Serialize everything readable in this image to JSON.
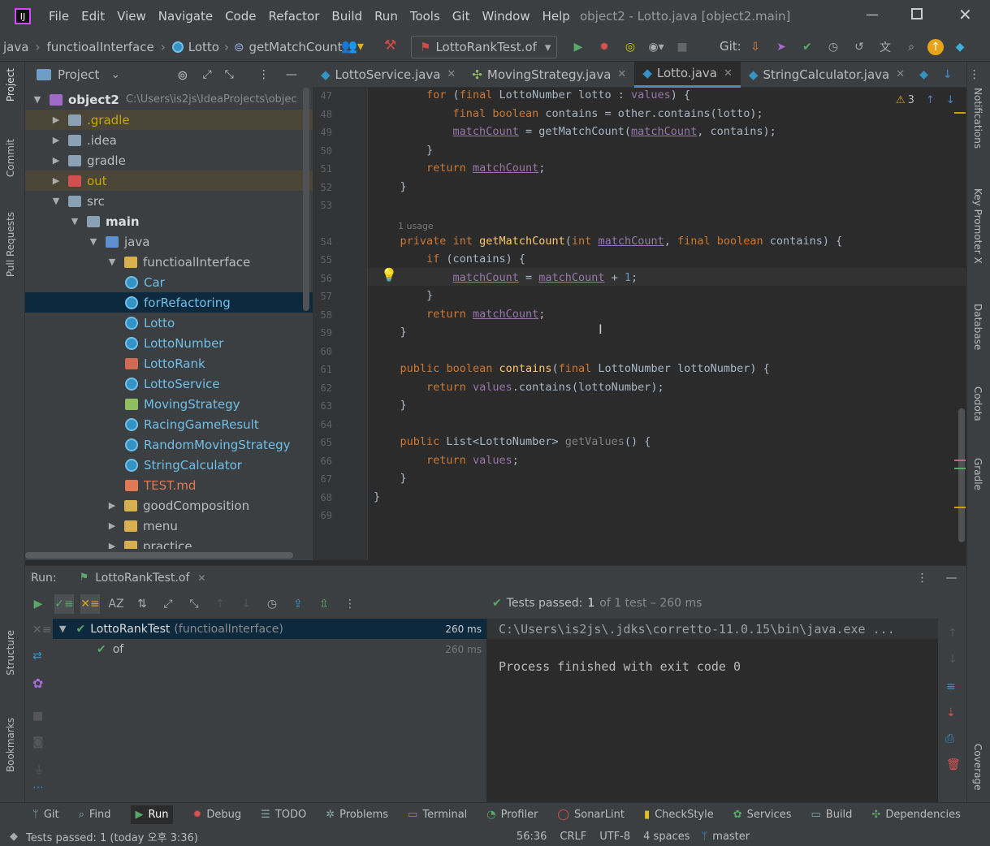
{
  "menu": [
    "File",
    "Edit",
    "View",
    "Navigate",
    "Code",
    "Refactor",
    "Build",
    "Run",
    "Tools",
    "Git",
    "Window",
    "Help"
  ],
  "window_title": "object2 - Lotto.java [object2.main]",
  "breadcrumb": [
    "java",
    "functioalInterface",
    "Lotto",
    "getMatchCount"
  ],
  "run_config": "LottoRankTest.of",
  "git_label": "Git:",
  "project_panel": {
    "title": "Project",
    "root": "object2",
    "root_path": "C:\\Users\\is2js\\IdeaProjects\\objec",
    "items": [
      {
        "label": ".gradle",
        "indent": 1,
        "arrow": "right",
        "color": "#c8a800",
        "icon": "folder",
        "hl": true
      },
      {
        "label": ".idea",
        "indent": 1,
        "arrow": "right",
        "color": "#bbbbbb",
        "icon": "folder"
      },
      {
        "label": "gradle",
        "indent": 1,
        "arrow": "right",
        "color": "#bbbbbb",
        "icon": "folder"
      },
      {
        "label": "out",
        "indent": 1,
        "arrow": "right",
        "color": "#c8a800",
        "icon": "folder-red",
        "hl": true
      },
      {
        "label": "src",
        "indent": 1,
        "arrow": "down",
        "color": "#bbbbbb",
        "icon": "folder"
      },
      {
        "label": "main",
        "indent": 2,
        "arrow": "down",
        "color": "#dddddd",
        "icon": "folder",
        "bold": true
      },
      {
        "label": "java",
        "indent": 3,
        "arrow": "down",
        "color": "#bbbbbb",
        "icon": "folder-blue"
      },
      {
        "label": "functioalInterface",
        "indent": 4,
        "arrow": "down",
        "color": "#bbbbbb",
        "icon": "pkg"
      },
      {
        "label": "Car",
        "indent": 5,
        "arrow": "",
        "color": "#6fbfe8",
        "icon": "class"
      },
      {
        "label": "forRefactoring",
        "indent": 5,
        "arrow": "",
        "color": "#6fbfe8",
        "icon": "class",
        "sel": true
      },
      {
        "label": "Lotto",
        "indent": 5,
        "arrow": "",
        "color": "#6fbfe8",
        "icon": "class"
      },
      {
        "label": "LottoNumber",
        "indent": 5,
        "arrow": "",
        "color": "#6fbfe8",
        "icon": "class"
      },
      {
        "label": "LottoRank",
        "indent": 5,
        "arrow": "",
        "color": "#6fbfe8",
        "icon": "enum"
      },
      {
        "label": "LottoService",
        "indent": 5,
        "arrow": "",
        "color": "#6fbfe8",
        "icon": "class"
      },
      {
        "label": "MovingStrategy",
        "indent": 5,
        "arrow": "",
        "color": "#6fbfe8",
        "icon": "iface"
      },
      {
        "label": "RacingGameResult",
        "indent": 5,
        "arrow": "",
        "color": "#6fbfe8",
        "icon": "class"
      },
      {
        "label": "RandomMovingStrategy",
        "indent": 5,
        "arrow": "",
        "color": "#6fbfe8",
        "icon": "class"
      },
      {
        "label": "StringCalculator",
        "indent": 5,
        "arrow": "",
        "color": "#6fbfe8",
        "icon": "class"
      },
      {
        "label": "TEST.md",
        "indent": 5,
        "arrow": "",
        "color": "#e07a54",
        "icon": "md"
      },
      {
        "label": "goodComposition",
        "indent": 4,
        "arrow": "right",
        "color": "#bbbbbb",
        "icon": "pkg"
      },
      {
        "label": "menu",
        "indent": 4,
        "arrow": "right",
        "color": "#bbbbbb",
        "icon": "pkg"
      },
      {
        "label": "practice",
        "indent": 4,
        "arrow": "right",
        "color": "#bbbbbb",
        "icon": "pkg"
      }
    ]
  },
  "tabs": [
    {
      "label": "LottoService.java",
      "active": false,
      "icon": "class"
    },
    {
      "label": "MovingStrategy.java",
      "active": false,
      "icon": "iface"
    },
    {
      "label": "Lotto.java",
      "active": true,
      "icon": "class"
    },
    {
      "label": "StringCalculator.java",
      "active": false,
      "icon": "class"
    }
  ],
  "warning_count": "3",
  "code": [
    {
      "n": "47",
      "t": [
        [
          "        ",
          ""
        ],
        [
          "for",
          "kw"
        ],
        [
          " (",
          ""
        ],
        [
          "final",
          "kw"
        ],
        [
          " LottoNumber lotto : ",
          ""
        ],
        [
          "values",
          "fld"
        ],
        [
          ") {",
          ""
        ]
      ]
    },
    {
      "n": "48",
      "t": [
        [
          "            ",
          ""
        ],
        [
          "final",
          "kw"
        ],
        [
          " ",
          ""
        ],
        [
          "boolean",
          "kw"
        ],
        [
          " contains = other.contains(lotto);",
          ""
        ]
      ]
    },
    {
      "n": "49",
      "t": [
        [
          "            ",
          ""
        ],
        [
          "matchCount",
          "ul"
        ],
        [
          " = getMatchCount(",
          ""
        ],
        [
          "matchCount",
          "ul"
        ],
        [
          ", contains);",
          ""
        ]
      ]
    },
    {
      "n": "50",
      "t": [
        [
          "        }",
          ""
        ]
      ]
    },
    {
      "n": "51",
      "t": [
        [
          "        ",
          ""
        ],
        [
          "return",
          "kw"
        ],
        [
          " ",
          ""
        ],
        [
          "matchCount",
          "ul"
        ],
        [
          ";",
          ""
        ]
      ]
    },
    {
      "n": "52",
      "t": [
        [
          "    }",
          ""
        ]
      ]
    },
    {
      "n": "53",
      "t": [
        [
          "",
          ""
        ]
      ]
    },
    {
      "n": "",
      "usage": "1 usage"
    },
    {
      "n": "54",
      "t": [
        [
          "    ",
          ""
        ],
        [
          "private",
          "kw"
        ],
        [
          " ",
          ""
        ],
        [
          "int",
          "kw"
        ],
        [
          " ",
          ""
        ],
        [
          "getMatchCount",
          "fn"
        ],
        [
          "(",
          ""
        ],
        [
          "int",
          "kw"
        ],
        [
          " ",
          ""
        ],
        [
          "matchCount",
          "ul"
        ],
        [
          ", ",
          ""
        ],
        [
          "final",
          "kw"
        ],
        [
          " ",
          ""
        ],
        [
          "boolean",
          "kw"
        ],
        [
          " contains) {",
          ""
        ]
      ]
    },
    {
      "n": "55",
      "t": [
        [
          "        ",
          ""
        ],
        [
          "if",
          "kw"
        ],
        [
          " (contains) {",
          ""
        ]
      ]
    },
    {
      "n": "56",
      "t": [
        [
          "            ",
          ""
        ],
        [
          "matchCount",
          "ul"
        ],
        [
          " = ",
          ""
        ],
        [
          "matchCount",
          "ul"
        ],
        [
          " + ",
          ""
        ],
        [
          "1",
          "num"
        ],
        [
          ";",
          ""
        ]
      ]
    },
    {
      "n": "57",
      "t": [
        [
          "        }",
          ""
        ]
      ]
    },
    {
      "n": "58",
      "t": [
        [
          "        ",
          ""
        ],
        [
          "return",
          "kw"
        ],
        [
          " ",
          ""
        ],
        [
          "matchCount",
          "ul"
        ],
        [
          ";",
          ""
        ]
      ]
    },
    {
      "n": "59",
      "t": [
        [
          "    }",
          ""
        ]
      ]
    },
    {
      "n": "60",
      "t": [
        [
          "",
          ""
        ]
      ]
    },
    {
      "n": "61",
      "t": [
        [
          "    ",
          ""
        ],
        [
          "public",
          "kw"
        ],
        [
          " ",
          ""
        ],
        [
          "boolean",
          "kw"
        ],
        [
          " ",
          ""
        ],
        [
          "contains",
          "fn"
        ],
        [
          "(",
          ""
        ],
        [
          "final",
          "kw"
        ],
        [
          " LottoNumber lottoNumber) {",
          ""
        ]
      ]
    },
    {
      "n": "62",
      "t": [
        [
          "        ",
          ""
        ],
        [
          "return",
          "kw"
        ],
        [
          " ",
          ""
        ],
        [
          "values",
          "fld"
        ],
        [
          ".contains(lottoNumber);",
          ""
        ]
      ]
    },
    {
      "n": "63",
      "t": [
        [
          "    }",
          ""
        ]
      ]
    },
    {
      "n": "64",
      "t": [
        [
          "",
          ""
        ]
      ]
    },
    {
      "n": "65",
      "t": [
        [
          "    ",
          ""
        ],
        [
          "public",
          "kw"
        ],
        [
          " List<LottoNumber> ",
          ""
        ],
        [
          "getValues",
          "gv"
        ],
        [
          "() {",
          ""
        ]
      ]
    },
    {
      "n": "66",
      "t": [
        [
          "        ",
          ""
        ],
        [
          "return",
          "kw"
        ],
        [
          " ",
          ""
        ],
        [
          "values",
          "fld"
        ],
        [
          ";",
          ""
        ]
      ]
    },
    {
      "n": "67",
      "t": [
        [
          "    }",
          ""
        ]
      ]
    },
    {
      "n": "68",
      "t": [
        [
          "}",
          ""
        ]
      ]
    },
    {
      "n": "69",
      "t": [
        [
          "",
          ""
        ]
      ]
    }
  ],
  "run": {
    "label": "Run:",
    "tab": "LottoRankTest.of",
    "status_prefix": "Tests passed:",
    "status_count": "1",
    "status_rest": "of 1 test – 260 ms",
    "tree": [
      {
        "label": "LottoRankTest",
        "sub": "(functioalInterface)",
        "time": "260 ms"
      },
      {
        "label": "of",
        "sub": "",
        "time": "260 ms"
      }
    ],
    "console": [
      "C:\\Users\\is2js\\.jdks\\corretto-11.0.15\\bin\\java.exe ...",
      "",
      "Process finished with exit code 0"
    ]
  },
  "bottom_tools": [
    "Git",
    "Find",
    "Run",
    "Debug",
    "TODO",
    "Problems",
    "Terminal",
    "Profiler",
    "SonarLint",
    "CheckStyle",
    "Services",
    "Build",
    "Dependencies"
  ],
  "status": {
    "left": "Tests passed: 1 (today 오후 3:36)",
    "pos": "56:36",
    "eol": "CRLF",
    "enc": "UTF-8",
    "indent": "4 spaces",
    "branch": "master"
  },
  "left_tool_tabs": [
    "Project",
    "Commit",
    "Pull Requests",
    "Structure",
    "Bookmarks"
  ],
  "right_tool_tabs": [
    "Notifications",
    "Key Promoter X",
    "Database",
    "Codota",
    "Gradle",
    "Coverage"
  ]
}
